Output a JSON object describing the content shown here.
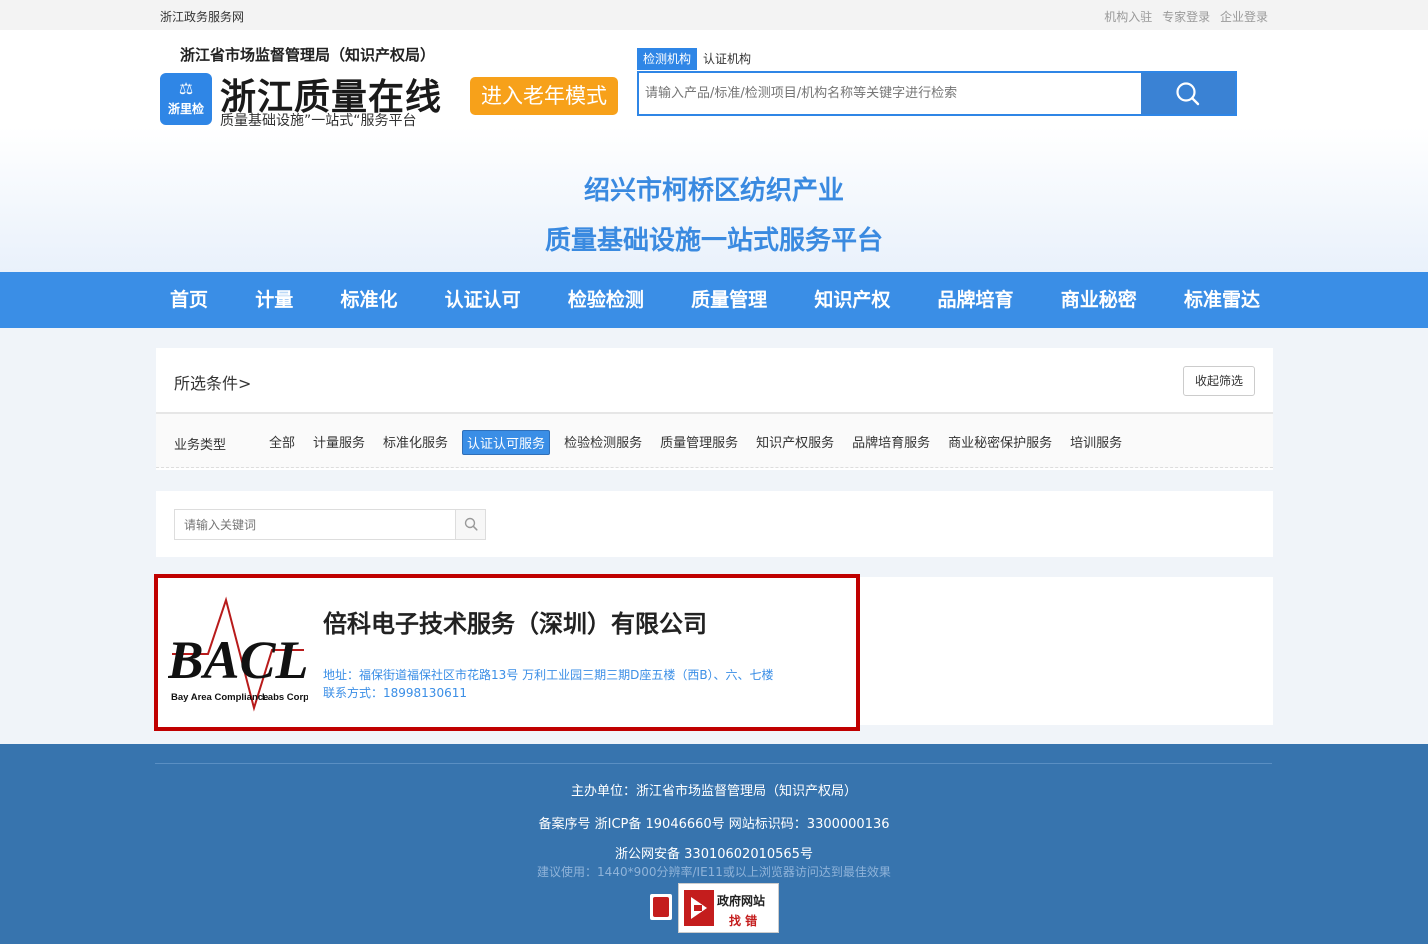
{
  "topbar": {
    "site_name": "浙江政务服务网",
    "links": [
      "机构入驻",
      "专家登录",
      "企业登录"
    ]
  },
  "header": {
    "org_name": "浙江省市场监督管理局（知识产权局）",
    "logo_text": "浙里检",
    "brand": "浙江质量在线",
    "slogan": "质量基础设施”一站式“服务平台",
    "elder_mode": "进入老年模式",
    "search_tabs": [
      "检测机构",
      "认证机构"
    ],
    "search_placeholder": "请输入产品/标准/检测项目/机构名称等关键字进行检索",
    "platform_title_1": "绍兴市柯桥区纺织产业",
    "platform_title_2": "质量基础设施一站式服务平台"
  },
  "nav": {
    "items": [
      "首页",
      "计量",
      "标准化",
      "认证认可",
      "检验检测",
      "质量管理",
      "知识产权",
      "品牌培育",
      "商业秘密",
      "标准雷达"
    ]
  },
  "filter": {
    "selected_label": "所选条件>",
    "collapse_label": "收起筛选",
    "business_type_label": "业务类型",
    "options": [
      "全部",
      "计量服务",
      "标准化服务",
      "认证认可服务",
      "检验检测服务",
      "质量管理服务",
      "知识产权服务",
      "品牌培育服务",
      "商业秘密保护服务",
      "培训服务"
    ],
    "active_option": "认证认可服务"
  },
  "keyword_search": {
    "placeholder": "请输入关键词"
  },
  "result": {
    "logo_letters": "BACL",
    "logo_caption_left": "Bay Area Compliance",
    "logo_caption_right": "Labs Corp.",
    "name": "倍科电子技术服务（深圳）有限公司",
    "address": "地址：福保街道福保社区市花路13号 万利工业园三期三期D座五楼（西B）、六、七楼",
    "contact": "联系方式：18998130611"
  },
  "footer": {
    "sponsor": "主办单位：浙江省市场监督管理局（知识产权局）",
    "icp": "备案序号 浙ICP备 19046660号 网站标识码：3300000136",
    "police": "浙公网安备 33010602010565号",
    "advice": "建议使用：1440*900分辨率/IE11或以上浏览器访问达到最佳效果",
    "gov_error_line1": "政府网站",
    "gov_error_line2": "找 错"
  },
  "colors": {
    "primary": "#3a8ee6",
    "accent_orange": "#f7a11a",
    "highlight_red": "#c00000",
    "footer_bg": "#3774ae"
  }
}
